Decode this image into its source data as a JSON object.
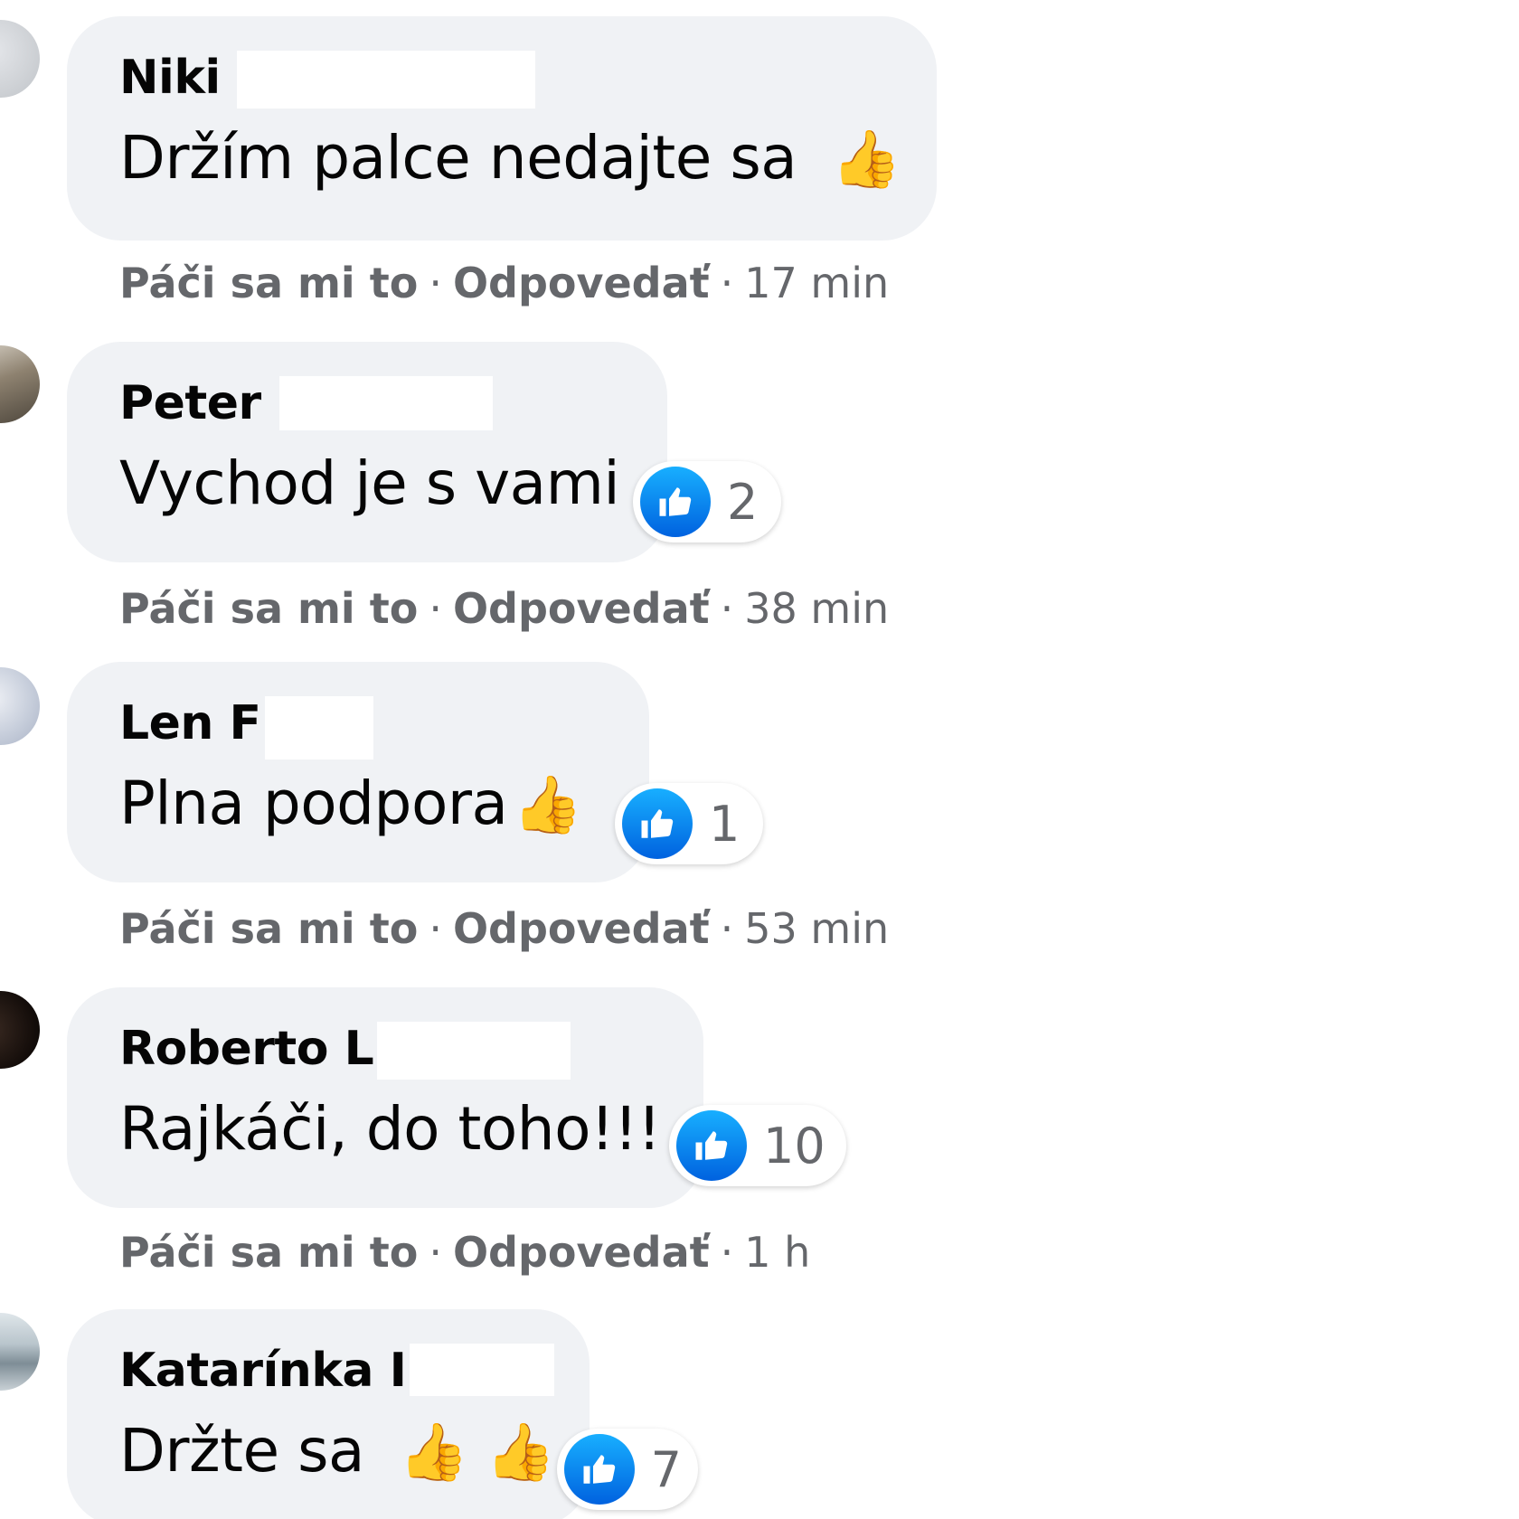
{
  "comments": [
    {
      "author": "Niki",
      "text": "Držím palce nedajte sa",
      "emoji": "👍",
      "reactions": null,
      "like_label": "Páči sa mi to",
      "reply_label": "Odpovedať",
      "separator": "·",
      "time": "17 min"
    },
    {
      "author": "Peter",
      "text": "Vychod je s vami",
      "emoji": "",
      "reactions": "2",
      "like_label": "Páči sa mi to",
      "reply_label": "Odpovedať",
      "separator": "·",
      "time": "38 min"
    },
    {
      "author": "Len F",
      "text": "Plna podpora",
      "emoji": "👍",
      "reactions": "1",
      "like_label": "Páči sa mi to",
      "reply_label": "Odpovedať",
      "separator": "·",
      "time": "53 min"
    },
    {
      "author": "Roberto L",
      "text": "Rajkáči, do toho!!!",
      "emoji": "",
      "reactions": "10",
      "like_label": "Páči sa mi to",
      "reply_label": "Odpovedať",
      "separator": "·",
      "time": "1 h"
    },
    {
      "author": "Katarínka I",
      "text": "Držte sa",
      "emoji": "👍 👍",
      "reactions": "7",
      "like_label": "",
      "reply_label": "",
      "separator": "",
      "time": ""
    }
  ],
  "icons": {
    "like_reaction": "thumbs-up-icon",
    "emoji_thumb": "thumbs-up-emoji"
  },
  "colors": {
    "bubble": "#f0f2f5",
    "like_blue": "#0a7cff",
    "secondary_text": "#65676b",
    "primary_text": "#050505"
  }
}
